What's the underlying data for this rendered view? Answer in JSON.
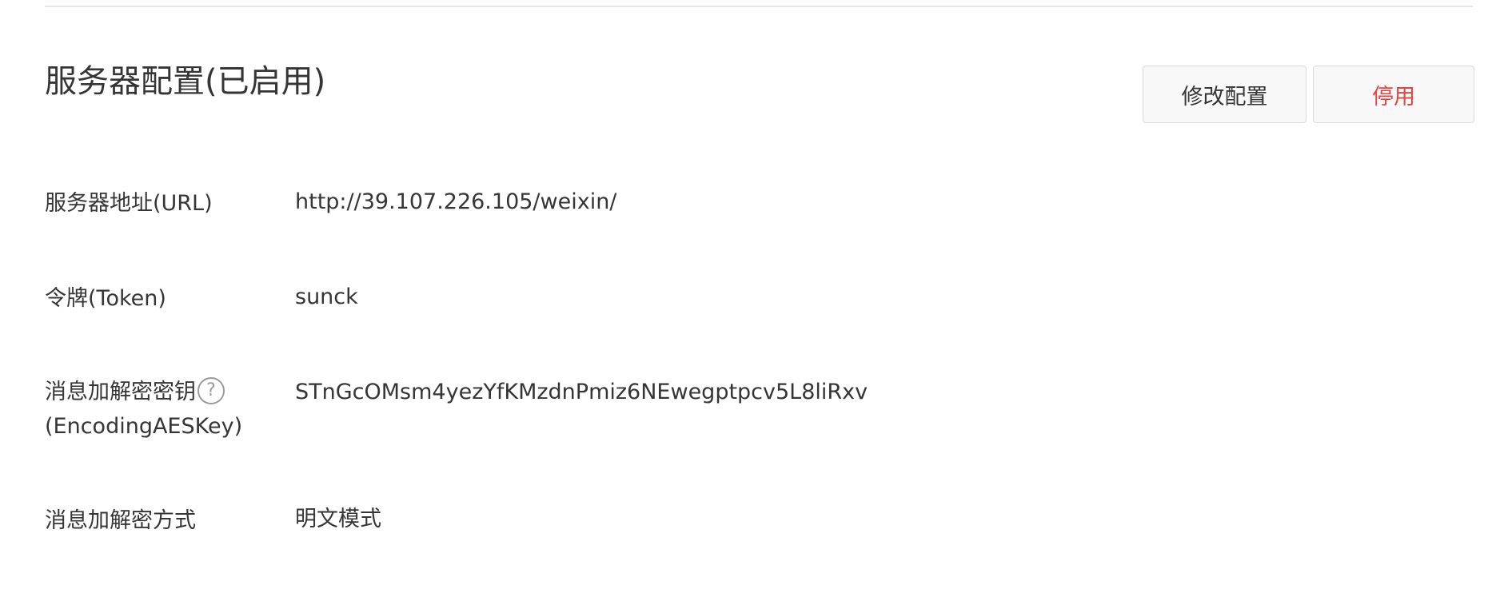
{
  "section": {
    "title": "服务器配置(已启用)"
  },
  "actions": {
    "edit_label": "修改配置",
    "disable_label": "停用"
  },
  "config": {
    "url_label": "服务器地址(URL)",
    "url_value": "http://39.107.226.105/weixin/",
    "token_label": "令牌(Token)",
    "token_value": "sunck",
    "aeskey_label_line1": "消息加解密密钥",
    "aeskey_label_line2": "(EncodingAESKey)",
    "aeskey_help": "?",
    "aeskey_value": "STnGcOMsm4yezYfKMzdnPmiz6NEwegptpcv5L8liRxv",
    "mode_label": "消息加解密方式",
    "mode_value": "明文模式"
  },
  "colors": {
    "danger": "#e64340",
    "text": "#353535",
    "divider": "#e7e7eb"
  }
}
